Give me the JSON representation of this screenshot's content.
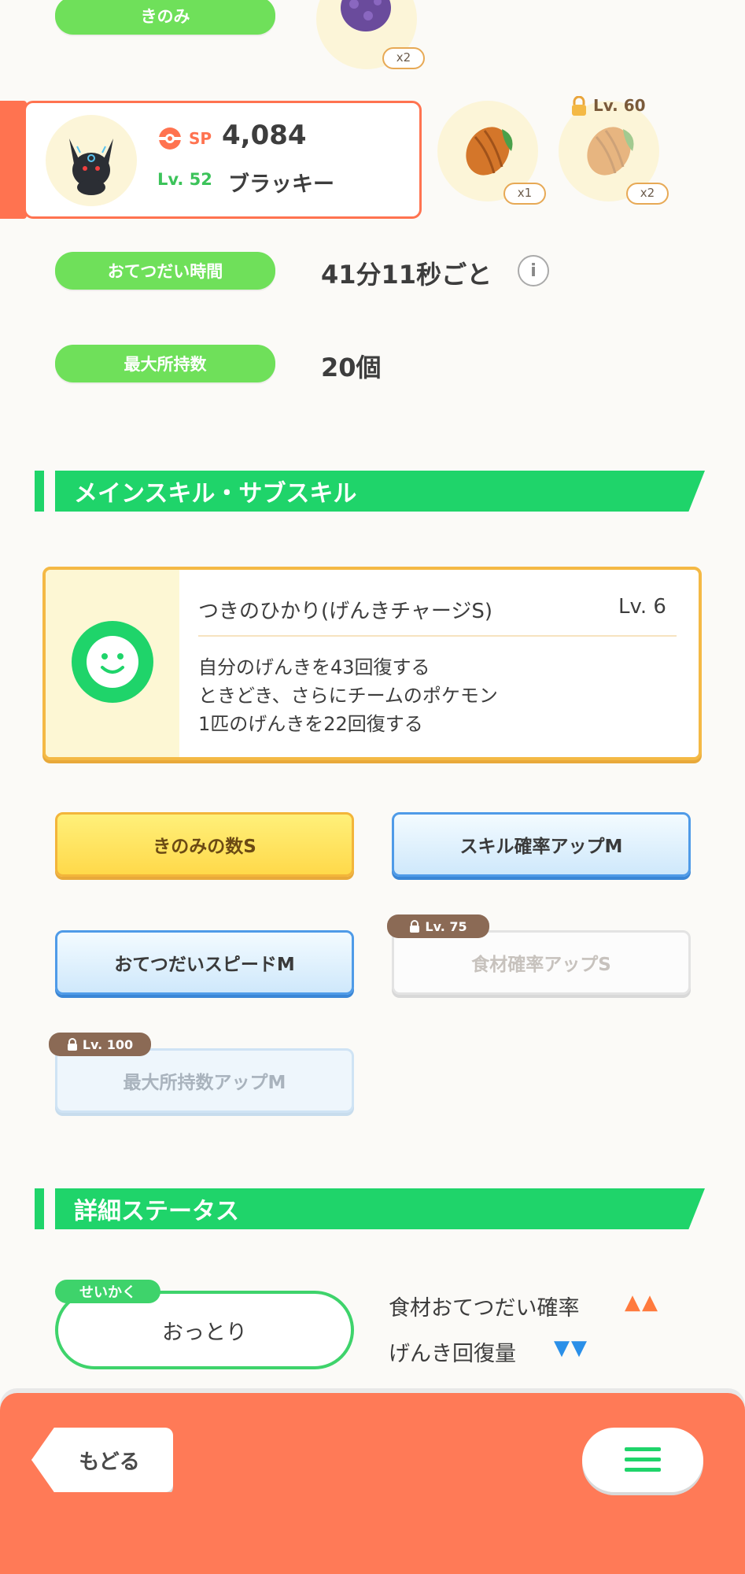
{
  "berry_row": {
    "label": "きのみ",
    "berry_count": "x2"
  },
  "pokemon_card": {
    "sp_label": "SP",
    "sp_value": "4,084",
    "level": "Lv. 52",
    "name": "ブラッキー"
  },
  "ingredients": [
    {
      "count": "x1",
      "locked": false
    },
    {
      "count": "x2",
      "locked": true,
      "lock_label": "Lv. 60"
    }
  ],
  "help_time": {
    "label": "おてつだい時間",
    "value": "41分11秒ごと"
  },
  "max_carry": {
    "label": "最大所持数",
    "value": "20個"
  },
  "skills_section": {
    "title": "メインスキル・サブスキル",
    "main_skill": {
      "name": "つきのひかり(げんきチャージS)",
      "level": "Lv. 6",
      "desc_lines": [
        "自分のげんきを43回復する",
        "ときどき、さらにチームのポケモン",
        "1匹のげんきを22回復する"
      ]
    },
    "sub_skills": [
      {
        "label": "きのみの数S"
      },
      {
        "label": "スキル確率アップM"
      },
      {
        "label": "おてつだいスピードM"
      },
      {
        "label": "食材確率アップS",
        "lock": "Lv. 75"
      },
      {
        "label": "最大所持数アップM",
        "lock": "Lv. 100"
      }
    ]
  },
  "details_section": {
    "title": "詳細ステータス",
    "nature_tag": "せいかく",
    "nature_value": "おっとり",
    "effects": [
      {
        "label": "食材おてつだい確率",
        "arrows": "▲▲"
      },
      {
        "label": "げんき回復量",
        "arrows": "▼▼"
      }
    ]
  },
  "footer": {
    "back_label": "もどる"
  },
  "colors": {
    "accent_green": "#1fd46a",
    "pill_green": "#6fe05a",
    "footer_orange": "#ff7a57",
    "up_arrow": "#ff7a3d",
    "down_arrow": "#2a8fe8"
  }
}
